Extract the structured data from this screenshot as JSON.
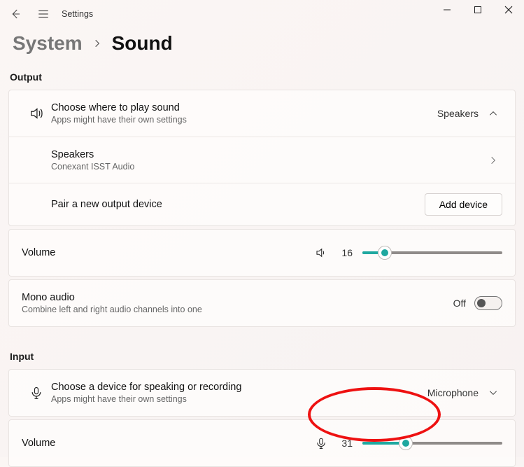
{
  "app": {
    "title": "Settings"
  },
  "breadcrumb": {
    "parent": "System",
    "current": "Sound"
  },
  "sections": {
    "output": "Output",
    "input": "Input"
  },
  "output": {
    "choose": {
      "title": "Choose where to play sound",
      "subtitle": "Apps might have their own settings",
      "selected": "Speakers"
    },
    "device": {
      "name": "Speakers",
      "driver": "Conexant ISST Audio"
    },
    "pair": {
      "label": "Pair a new output device",
      "button": "Add device"
    },
    "volume": {
      "label": "Volume",
      "value": "16",
      "percent": 16
    },
    "mono": {
      "title": "Mono audio",
      "subtitle": "Combine left and right audio channels into one",
      "state_label": "Off"
    }
  },
  "input": {
    "choose": {
      "title": "Choose a device for speaking or recording",
      "subtitle": "Apps might have their own settings",
      "selected": "Microphone"
    },
    "volume": {
      "label": "Volume",
      "value": "31",
      "percent": 31
    }
  }
}
